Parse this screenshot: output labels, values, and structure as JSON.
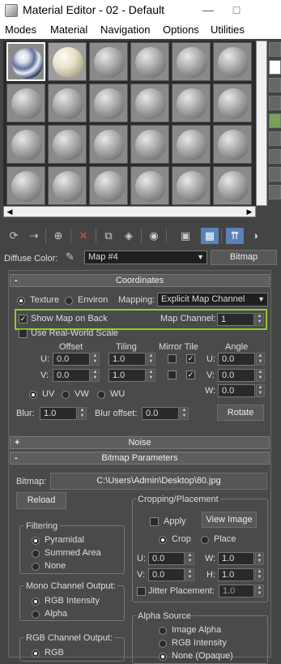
{
  "window": {
    "title": "Material Editor - 02 - Default",
    "minimize": "—",
    "maximize": "□"
  },
  "menu": [
    "Modes",
    "Material",
    "Navigation",
    "Options",
    "Utilities"
  ],
  "diffuse": {
    "label": "Diffuse Color:",
    "map_name": "Map #4",
    "type_button": "Bitmap"
  },
  "coordinates": {
    "header": "Coordinates",
    "collapse": "-",
    "texture_label": "Texture",
    "environ_label": "Environ",
    "mapping_label": "Mapping:",
    "mapping_value": "Explicit Map Channel",
    "show_map_on_back": "Show Map on Back",
    "map_channel_label": "Map Channel:",
    "map_channel_value": "1",
    "use_real_world": "Use Real-World Scale",
    "offset_label": "Offset",
    "tiling_label": "Tiling",
    "mirror_tile_label": "Mirror Tile",
    "angle_label": "Angle",
    "u_label": "U:",
    "v_label": "V:",
    "w_label": "W:",
    "u_offset": "0.0",
    "v_offset": "0.0",
    "u_tiling": "1.0",
    "v_tiling": "1.0",
    "u_angle": "0.0",
    "v_angle": "0.0",
    "w_angle": "0.0",
    "uv": "UV",
    "vw": "VW",
    "wu": "WU",
    "blur_label": "Blur:",
    "blur_value": "1.0",
    "blur_offset_label": "Blur offset:",
    "blur_offset_value": "0.0",
    "rotate": "Rotate"
  },
  "noise": {
    "header": "Noise",
    "expand": "+"
  },
  "bitmap_params": {
    "header": "Bitmap Parameters",
    "collapse": "-",
    "bitmap_label": "Bitmap:",
    "bitmap_path": "C:\\Users\\Admin\\Desktop\\80.jpg",
    "reload": "Reload",
    "filtering_label": "Filtering",
    "pyramidal": "Pyramidal",
    "summed_area": "Summed Area",
    "none": "None",
    "mono_label": "Mono Channel Output:",
    "rgb_intensity": "RGB Intensity",
    "alpha": "Alpha",
    "rgb_out_label": "RGB Channel Output:",
    "rgb": "RGB",
    "cropping_label": "Cropping/Placement",
    "apply": "Apply",
    "view_image": "View Image",
    "crop": "Crop",
    "place": "Place",
    "u_label": "U:",
    "v_label": "V:",
    "w_label": "W:",
    "h_label": "H:",
    "u_val": "0.0",
    "v_val": "0.0",
    "w_val": "1.0",
    "h_val": "1.0",
    "jitter_label": "Jitter Placement:",
    "jitter_value": "1.0",
    "alpha_source_label": "Alpha Source",
    "image_alpha": "Image Alpha",
    "rgb_intensity2": "RGB Intensity",
    "none_opaque": "None (Opaque)"
  }
}
